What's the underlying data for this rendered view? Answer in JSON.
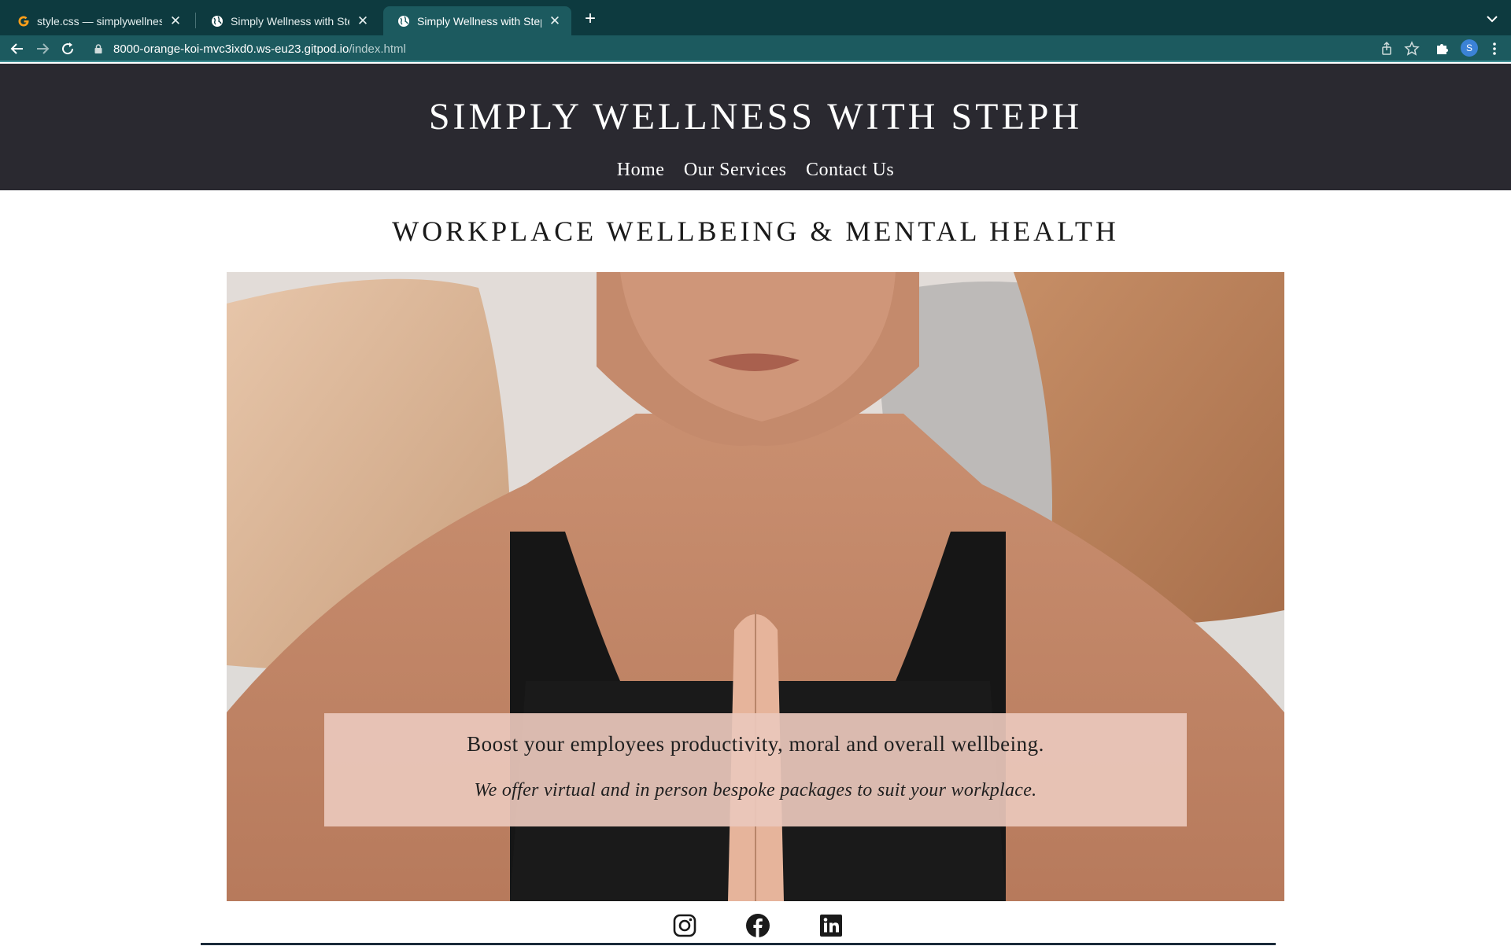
{
  "browser": {
    "tabs": [
      {
        "title": "style.css — simplywellness — (",
        "favicon": "gitpod-icon",
        "active": false
      },
      {
        "title": "Simply Wellness with Steph",
        "favicon": "globe-icon",
        "active": false
      },
      {
        "title": "Simply Wellness with Steph",
        "favicon": "globe-icon",
        "active": true
      }
    ],
    "url_host": "8000-orange-koi-mvc3ixd0.ws-eu23.gitpod.io",
    "url_path": "/index.html",
    "profile_initial": "S",
    "colors": {
      "tabbar": "#0d3a3f",
      "toolbar": "#1c5a5f",
      "profile": "#3b82d6"
    }
  },
  "site": {
    "title": "SIMPLY WELLNESS WITH STEPH",
    "nav": [
      "Home",
      "Our Services",
      "Contact Us"
    ],
    "heading": "WORKPLACE WELLBEING & MENTAL HEALTH",
    "hero": {
      "line1": "Boost your employees productivity, moral and overall wellbeing.",
      "line2": "We offer virtual and in person bespoke packages to suit your workplace."
    },
    "social": [
      "instagram-icon",
      "facebook-icon",
      "linkedin-icon"
    ],
    "colors": {
      "header_bg": "#2a2930",
      "hero_box": "#eac8bc",
      "footer_rule": "#1b2b3a"
    }
  }
}
